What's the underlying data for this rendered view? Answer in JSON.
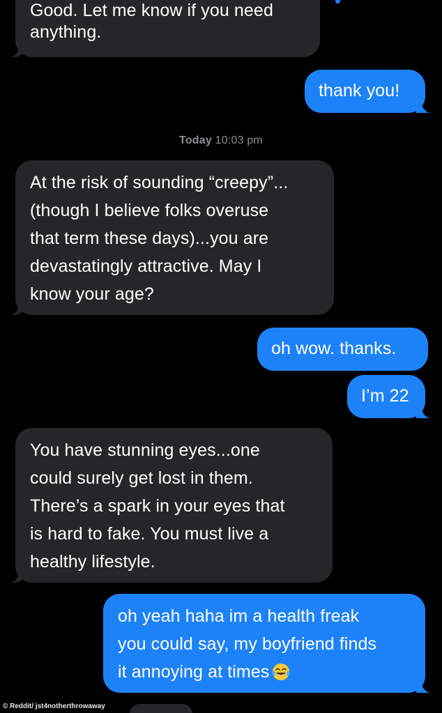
{
  "thread": {
    "messages": [
      {
        "direction": "incoming",
        "lines": [
          "Good. Let me know if you need",
          "anything."
        ]
      },
      {
        "direction": "outgoing",
        "lines": [
          "thank you!"
        ]
      },
      {
        "direction": "incoming",
        "lines": [
          "At the risk of sounding “creepy”...",
          "(though I believe folks overuse",
          "that term these days)...you are",
          "devastatingly attractive. May I",
          "know your age?"
        ]
      },
      {
        "direction": "outgoing",
        "lines": [
          "oh wow. thanks."
        ]
      },
      {
        "direction": "outgoing",
        "lines": [
          "I’m 22"
        ]
      },
      {
        "direction": "incoming",
        "lines": [
          "You have stunning eyes...one",
          "could surely get lost in them.",
          "There’s a spark in your eyes that",
          "is hard to fake. You must live a",
          "healthy lifestyle."
        ]
      },
      {
        "direction": "outgoing",
        "lines": [
          "oh yeah haha im a health freak",
          "you could say, my boyfriend finds",
          "it annoying at times"
        ],
        "trailing_emoji": "face-with-tears-of-joy-icon"
      }
    ],
    "timestamp": {
      "day": "Today",
      "time": "10:03 pm"
    }
  },
  "credit": "© Reddit/ jst4notherthrowaway",
  "colors": {
    "background": "#000000",
    "incoming_bubble": "#262628",
    "outgoing_bubble": "#1d82f7",
    "timestamp": "#8e8e93",
    "text": "#ffffff"
  }
}
